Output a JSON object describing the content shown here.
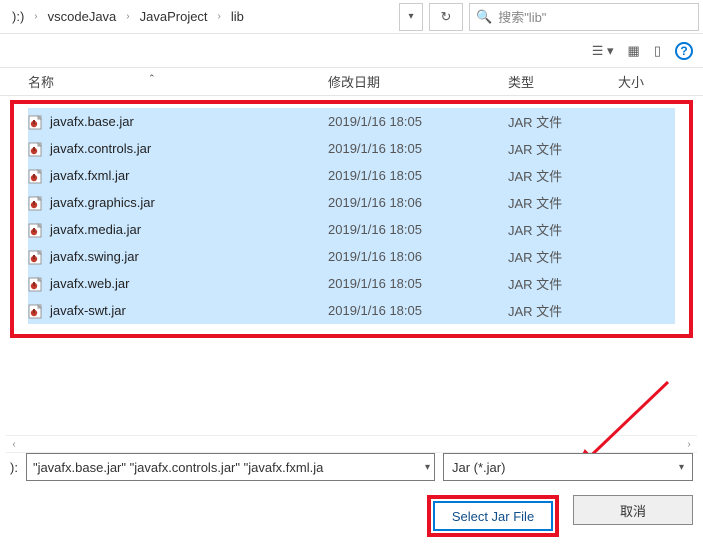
{
  "breadcrumb": {
    "drive": "):)",
    "items": [
      "vscodeJava",
      "JavaProject",
      "lib"
    ]
  },
  "search": {
    "placeholder": "搜索\"lib\""
  },
  "columns": {
    "name": "名称",
    "modified": "修改日期",
    "type": "类型",
    "size": "大小"
  },
  "files": [
    {
      "name": "javafx.base.jar",
      "modified": "2019/1/16 18:05",
      "type": "JAR 文件"
    },
    {
      "name": "javafx.controls.jar",
      "modified": "2019/1/16 18:05",
      "type": "JAR 文件"
    },
    {
      "name": "javafx.fxml.jar",
      "modified": "2019/1/16 18:05",
      "type": "JAR 文件"
    },
    {
      "name": "javafx.graphics.jar",
      "modified": "2019/1/16 18:06",
      "type": "JAR 文件"
    },
    {
      "name": "javafx.media.jar",
      "modified": "2019/1/16 18:05",
      "type": "JAR 文件"
    },
    {
      "name": "javafx.swing.jar",
      "modified": "2019/1/16 18:06",
      "type": "JAR 文件"
    },
    {
      "name": "javafx.web.jar",
      "modified": "2019/1/16 18:05",
      "type": "JAR 文件"
    },
    {
      "name": "javafx-swt.jar",
      "modified": "2019/1/16 18:05",
      "type": "JAR 文件"
    }
  ],
  "filename_field": {
    "label": "):",
    "value": "\"javafx.base.jar\" \"javafx.controls.jar\" \"javafx.fxml.ja"
  },
  "filter": {
    "value": "Jar (*.jar)"
  },
  "buttons": {
    "select": "Select Jar File",
    "cancel": "取消"
  }
}
